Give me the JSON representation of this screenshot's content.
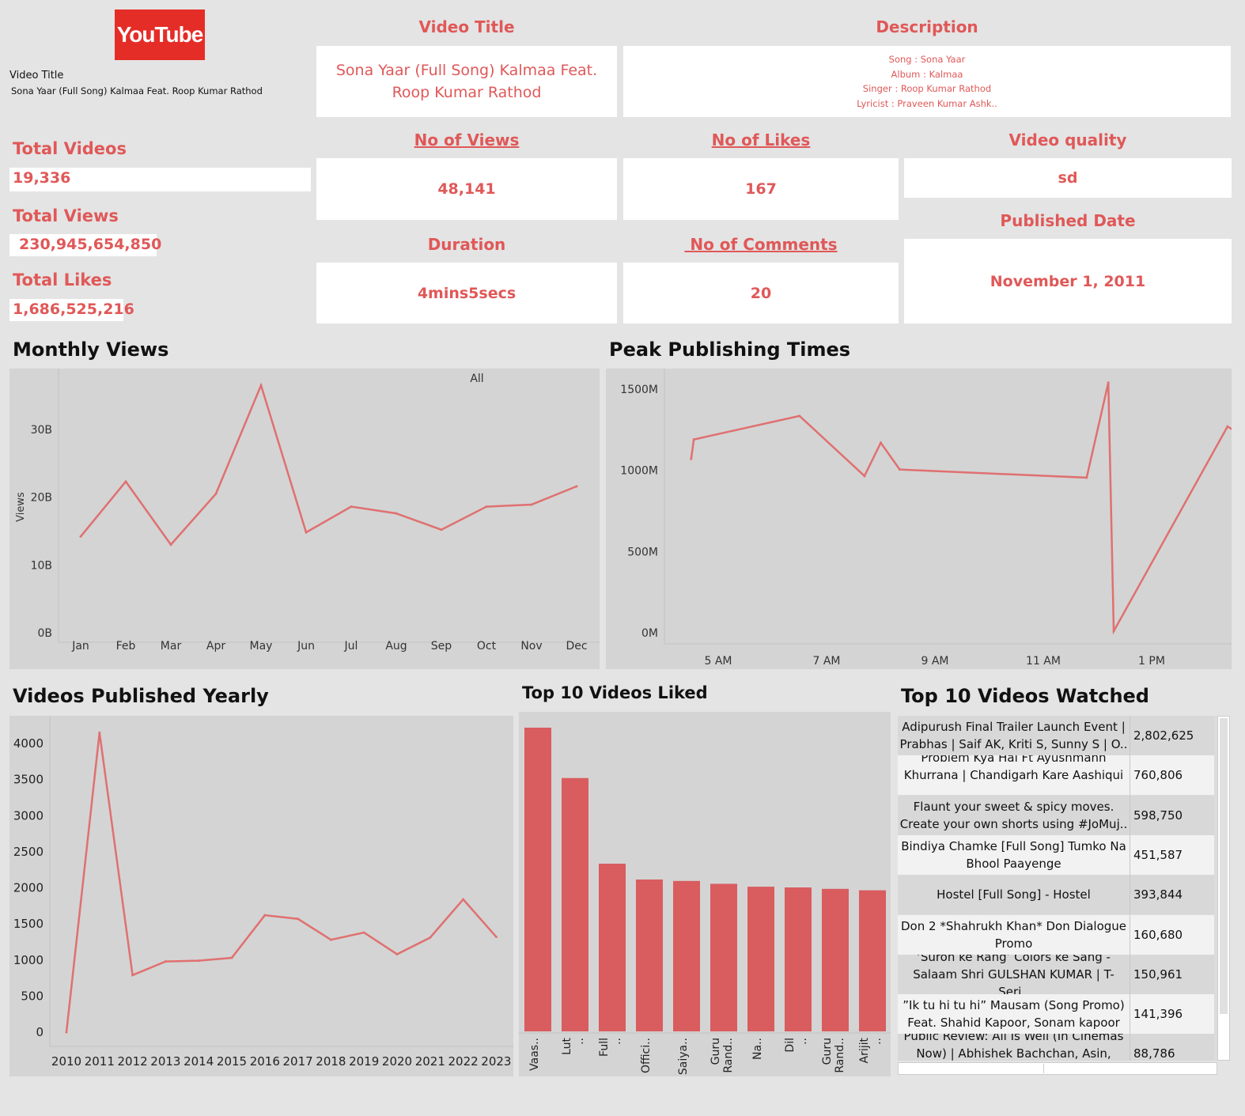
{
  "logo": {
    "you": "You",
    "tube": "Tube",
    "bg": "#e52d27"
  },
  "side_title": {
    "label": "Video Title",
    "value": "Sona Yaar (Full Song) Kalmaa Feat. Roop Kumar Rathod"
  },
  "headers": {
    "video_title": "Video Title",
    "description": "Description",
    "views": "No of Views",
    "likes": "No of Likes",
    "quality": "Video quality",
    "duration": "Duration",
    "comments": " No of Comments",
    "published": "Published Date"
  },
  "values": {
    "video_title": "Sona Yaar (Full Song) Kalmaa Feat. Roop Kumar Rathod",
    "description": [
      "Song : Sona Yaar",
      "Album : Kalmaa",
      "Singer : Roop Kumar Rathod",
      "Lyricist : Praveen Kumar Ashk.."
    ],
    "views": "48,141",
    "likes": "167",
    "quality": "sd",
    "duration": "4mins5secs",
    "comments": "20",
    "published": "November 1, 2011"
  },
  "kpis": {
    "total_videos_label": "Total Videos",
    "total_videos": "19,336",
    "total_views_label": "Total Views",
    "total_views": "230,945,654,850",
    "total_likes_label": "Total Likes",
    "total_likes": "1,686,525,216"
  },
  "colors": {
    "accent": "#e05858",
    "line": "#e07070",
    "bar": "#d95c5f",
    "panel": "#d4d4d4"
  },
  "chart_data": [
    {
      "type": "line",
      "title": "Monthly Views",
      "filter_label": "All",
      "ylabel": "Views",
      "categories": [
        "Jan",
        "Feb",
        "Mar",
        "Apr",
        "May",
        "Jun",
        "Jul",
        "Aug",
        "Sep",
        "Oct",
        "Nov",
        "Dec"
      ],
      "values": [
        14.2,
        22.3,
        13.0,
        20.5,
        36.5,
        14.8,
        18.6,
        17.6,
        15.2,
        18.6,
        18.9,
        21.6
      ],
      "unit": "B",
      "yticks": [
        "0B",
        "10B",
        "20B",
        "30B"
      ],
      "ylim": [
        0,
        38.5
      ]
    },
    {
      "type": "line",
      "title": "Peak Publishing Times",
      "xticks": [
        "5 AM",
        "7 AM",
        "9 AM",
        "11 AM",
        "1 PM"
      ],
      "x_hours": [
        4.5,
        4.55,
        6.5,
        7.7,
        8.0,
        8.35,
        11.8,
        12.2,
        12.3,
        14.4,
        14.55
      ],
      "values": [
        1070,
        1190,
        1335,
        965,
        1170,
        1005,
        955,
        1540,
        10,
        1270,
        1240
      ],
      "unit": "M",
      "yticks": [
        "0M",
        "500M",
        "1000M",
        "1500M"
      ],
      "ylim": [
        0,
        1600
      ]
    },
    {
      "type": "line",
      "title": "Videos Published Yearly",
      "categories": [
        "2010",
        "2011",
        "2012",
        "2013",
        "2014",
        "2015",
        "2016",
        "2017",
        "2018",
        "2019",
        "2020",
        "2021",
        "2022",
        "2023"
      ],
      "values": [
        0,
        4150,
        790,
        980,
        990,
        1030,
        1620,
        1570,
        1280,
        1380,
        1080,
        1310,
        1840,
        1320
      ],
      "yticks": [
        "0",
        "500",
        "1000",
        "1500",
        "2000",
        "2500",
        "3000",
        "3500",
        "4000"
      ],
      "ylim": [
        0,
        4400
      ]
    },
    {
      "type": "bar",
      "title": "Top 10 Videos Liked",
      "categories": [
        "Vaas..",
        "Lut ..",
        "Full ..",
        "Offici..",
        "Saiya..",
        "Guru Rand..",
        "Na..",
        "Dil ..",
        "Guru Rand..",
        "Arijit .."
      ],
      "values": [
        4220,
        3520,
        2330,
        2110,
        2090,
        2050,
        2010,
        2000,
        1980,
        1960
      ],
      "ylim": [
        0,
        4300
      ]
    }
  ],
  "top_watched": {
    "title": "Top 10 Videos Watched",
    "rows": [
      {
        "title": "Adipurush Final Trailer Launch Event | Prabhas | Saif AK, Kriti S, Sunny S | O..",
        "views": "2,802,625"
      },
      {
        "title": "Problem Kya Hai Ft Ayushmann Khurrana | Chandigarh Kare Aashiqui ..",
        "views": "760,806"
      },
      {
        "title": "Flaunt your sweet & spicy moves. Create your own shorts using #JoMuj..",
        "views": "598,750"
      },
      {
        "title": "Bindiya Chamke [Full Song] Tumko Na Bhool Paayenge",
        "views": "451,587"
      },
      {
        "title": "Hostel [Full Song] - Hostel",
        "views": "393,844"
      },
      {
        "title": "Don 2 *Shahrukh Khan*  Don Dialogue Promo",
        "views": "160,680"
      },
      {
        "title": "‘Suron ke Rang’ Colors ke Sang - Salaam Shri GULSHAN KUMAR | T-Seri..",
        "views": "150,961"
      },
      {
        "title": "”Ik tu hi tu hi” Mausam (Song Promo) Feat. Shahid Kapoor, Sonam kapoor",
        "views": "141,396"
      },
      {
        "title": "Public Review: All Is Well (In Cinemas Now) | Abhishek Bachchan, Asin, Rishi..",
        "views": "88,786"
      }
    ]
  }
}
